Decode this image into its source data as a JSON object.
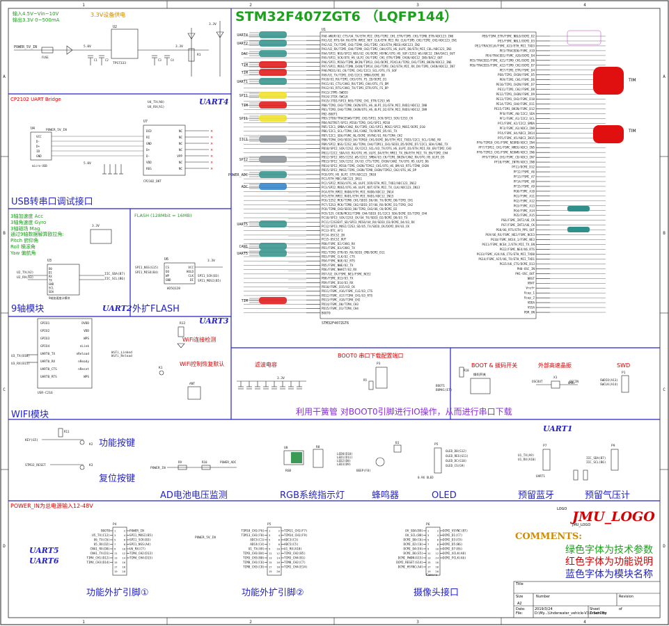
{
  "sheet": {
    "title": "STM32F407ZGT6 （LQFP144）",
    "mcu_ref": "U1",
    "mcu_part": "STM32F407ZGT6",
    "grid_top": [
      "1",
      "2",
      "3",
      "4",
      "5",
      "6"
    ],
    "grid_side": [
      "A",
      "B",
      "C",
      "D"
    ]
  },
  "modules": {
    "power_note": "输入4.5V~Vin~10V\n输出3.3V 0~500mA",
    "power_title": "3.3V设备供电",
    "usb_bridge": "CP2102 UART Bridge",
    "uart4": "UART4",
    "usb_title": "USB转串口调试接口",
    "imu_desc": "3轴加速度 Acc\n3轴角速度 Gyro\n3轴磁场 Mag\n通过9轴数据解算欧拉角:\nPitch 俯仰角\nRoll 横滚角\nYaw 偏航角",
    "imu_title": "9轴模块",
    "uart2": "UART2",
    "flash_note": "FLASH (128Mbit = 16MB)",
    "flash_title": "外扩FLASH",
    "uart3": "UART3",
    "wifi_detect": "WiFi连接检测",
    "wifi_ctrl": "WiFi控制恢复默认",
    "wifi_title": "WIFI模块",
    "filter_cap": "滤波电容",
    "boot0_title": "BOOT0 串口下载配置端口",
    "boot_switch": "BOOT & 拨码开关",
    "ext_osc": "外部高速晶振",
    "swd": "SWD",
    "boot0_desc": "利用干簧管 对BOOT0引脚进行IO操作，从而进行串口下载",
    "func_key": "功能按键",
    "reset_key": "复位按键",
    "ad_title": "AD电池电压监测",
    "rgb_title": "RGB系统指示灯",
    "buzzer_title": "蜂鸣器",
    "oled_title": "OLED",
    "uart1": "UART1",
    "bt_title": "预留蓝牙",
    "baro_title": "预留气压计",
    "power_in_note": "POWER_IN为总电源输入12-48V",
    "uart5": "UART5",
    "uart6": "UART6",
    "ext1_title": "功能外扩引脚①",
    "ext2_title": "功能外扩引脚②",
    "cam_title": "摄像头接口",
    "logo_text": "JMU_LOGO",
    "logo_small": "LOGO",
    "logo_sub": "JMU_LOGO",
    "comments": "COMMENTS:",
    "cmt_green": "绿色字体为技术参数",
    "cmt_red": "红色字体为功能说明",
    "cmt_blue": "蓝色字体为模块名称"
  },
  "title_block": {
    "title": "Title",
    "size_label": "Size",
    "size": "A2",
    "number_label": "Number",
    "revision_label": "Revision",
    "date_label": "Date:",
    "date": "2019/3/24",
    "sheet_label": "Sheet",
    "of": "of",
    "file_label": "File:",
    "file": "D:\\My...\\Underwater_vehicle-V3.0.SchDoc",
    "drawn_label": "Drawn By:"
  },
  "tags": {
    "tim_right": "TIM",
    "tim_right2": "TIM"
  },
  "colors": {
    "frame": "#2323c8",
    "wire": "#1a1a1a",
    "green_title": "#1ba11b",
    "blue_label": "#2323c8",
    "red_text": "#d40000",
    "orange": "#d08a00",
    "tag_red": "#e01010",
    "tag_yellow": "#f0e020",
    "tag_grey": "#8a8f96",
    "tag_teal": "#2f8f8a",
    "tag_blue": "#2a80c8",
    "tag_magenta": "#b000b0"
  },
  "mcu_pins_left": [
    "PA0-WKUP/U2_CTS/U4_TX/ETH_MII_CRS/TIM2_CH1_ETR/TIM5_CH1/TIM8_ETR/ADC123_IN0",
    "PA1/U2_RTS/U4_RX/ETH_RMII_REF_CLK/ETH_MII_RX_CLK/TIM5_CH2/TIM2_CH2/ADC123_IN1",
    "PA2/U2_TX/TIM5_CH3/TIM9_CH1/TIM2_CH3/ETH_MDIO/ADC123_IN2",
    "PA3/U2_RX/TIM5_CH4/TIM9_CH2/TIM2_CH4/OTG_HS_ULPI_D0/ETH_MII_COL/ADC123_IN3",
    "PA4/SPI1_NSS/SPI3_NSS/U2_CK/DCMI_HSYNC/OTG_HS_SOF/I2S3_WS/ADC12_IN4/DAC1_OUT",
    "PA5/SPI1_SCK/OTG_HS_ULPI_CK/TIM2_CH1_ETR/TIM8_CH1N/ADC12_IN5/DAC2_OUT",
    "PA6/SPI1_MISO/TIM8_BKIN/TIM13_CH1/DCMI_PIXCLK/TIM3_CH1/TIM1_BKIN/ADC12_IN6",
    "PA7/SPI1_MOSI/TIM8_CH1N/TIM14_CH1/TIM3_CH2/ETH_MII_RX_DV/TIM1_CH1N/ADC12_IN7",
    "PA8/MCO1/U1_CK/TIM1_CH1/I2C3_SCL/OTG_FS_SOF",
    "PA9/U1_TX/TIM1_CH2/I2C3_SMBA/DCMI_D0",
    "PA10/U1_RX/TIM1_CH3/OTG_FS_ID/DCMI_D1",
    "PA11/U1_CTS/CAN1_RX/TIM1_CH4/OTG_FS_DM",
    "PA12/U1_RTS/CAN1_TX/TIM1_ETR/OTG_FS_DP",
    "PA13/JTMS-SWDIO",
    "PA14/JTCK-SWCLK",
    "PA15/JTDI/SPI3_NSS/TIM2_CH1_ETR/I2S3_WS",
    "PB0/TIM3_CH3/TIM8_CH2N/OTG_HS_ULPI_D1/ETH_MII_RXD2/ADC12_IN8",
    "PB1/TIM3_CH4/TIM8_CH3N/OTG_HS_ULPI_D2/ETH_MII_RXD3/ADC12_IN9",
    "PB2-BOOT1",
    "PB3/JTDO/TRACESWO/TIM2_CH2/SPI1_SCK/SPI3_SCK/I2S3_CK",
    "PB4/NJTRST/SPI3_MISO/TIM3_CH1/SPI1_MISO",
    "PB5/I2C1_SMBA/CAN2_RX/TIM3_CH2/SPI1_MOSI/SPI3_MOSI/DCMI_D10",
    "PB6/I2C1_SCL/TIM4_CH1/CAN2_TX/DCMI_D5/U1_TX",
    "PB7/I2C1_SDA/FSMC_NL/DCMI_VSYNC/U1_RX/TIM4_CH2",
    "PB8/TIM4_CH3/SDIO_D4/TIM10_CH1/DCMI_D6/ETH_MII_TXD3/I2C1_SCL/CAN1_RX",
    "PB9/SPI2_NSS/I2S2_WS/TIM4_CH4/TIM11_CH1/SDIO_D5/DCMI_D7/I2C1_SDA/CAN1_TX",
    "PB10/SPI2_SCK/I2S2_CK/I2C2_SCL/U3_TX/OTG_HS_ULPI_D3/ETH_MII_RX_ER/TIM2_CH3",
    "PB11/I2C2_SDA/U3_RX/OTG_HS_ULPI_D4/ETH_RMII_TX_EN/ETH_MII_TX_EN/TIM2_CH4",
    "PB12/SPI2_NSS/I2S2_WS/I2C2_SMBA/U3_CK/TIM1_BKIN/CAN2_RX/OTG_HS_ULPI_D5",
    "PB13/SPI2_SCK/I2S2_CK/U3_CTS/TIM1_CH1N/CAN2_TX/OTG_HS_ULPI_D6",
    "PB14/SPI2_MISO/TIM1_CH2N/TIM12_CH1/OTG_HS_DM/U3_RTS/TIM8_CH2N",
    "PB15/SPI2_MOSI/TIM1_CH3N/TIM8_CH3N/TIM12_CH2/OTG_HS_DP",
    "PC0/OTG_HS_ULPI_STP/ADC123_IN10",
    "PC1/ETH_MDC/ADC123_IN11",
    "PC2/SPI2_MISO/OTG_HS_ULPI_DIR/ETH_MII_TXD2/ADC123_IN12",
    "PC3/SPI2_MOSI/OTG_HS_ULPI_NXT/ETH_MII_TX_CLK/ADC123_IN13",
    "PC4/ETH_RMII_RXD0/ETH_MII_RXD0/ADC12_IN14",
    "PC5/ETH_RMII_RXD1/ETH_MII_RXD1/ADC12_IN15",
    "PC6/I2S2_MCK/TIM8_CH1/SDIO_D6/U6_TX/DCMI_D0/TIM3_CH1",
    "PC7/I2S3_MCK/TIM8_CH2/SDIO_D7/U6_RX/DCMI_D1/TIM3_CH2",
    "PC8/TIM8_CH3/SDIO_D0/TIM3_CH3/U6_CK/DCMI_D2",
    "PC9/I2S_CKIN/MCO2/TIM8_CH4/SDIO_D1/I2C3_SDA/DCMI_D3/TIM3_CH4",
    "PC10/SPI3_SCK/I2S3_CK/U4_TX/SDIO_D2/DCMI_D8/U3_TX",
    "PC11/I2S3EXT_SD/SPI3_MISO/U4_RX/SDIO_D3/DCMI_D4/U3_RX",
    "PC12/SPI3_MOSI/I2S3_SD/U5_TX/SDIO_CK/DCMI_D9/U3_CK",
    "PC13-RTC_AF1",
    "PC14-OSC32_IN",
    "PC15-OSC32_OUT",
    "PD0/FSMC_D2/CAN1_RX",
    "PD1/FSMC_D3/CAN1_TX",
    "PD2/TIM3_ETR/U5_RX/SDIO_CMD/DCMI_D11",
    "PD3/FSMC_CLK/U2_CTS",
    "PD4/FSMC_NOE/U2_RTS",
    "PD5/FSMC_NWE/U2_TX",
    "PD6/FSMC_NWAIT/U2_RX",
    "PD7/U2_CK/FSMC_NE1/FSMC_NCE2",
    "PD8/FSMC_D13/U3_TX",
    "PD9/FSMC_D14/U3_RX",
    "PD10/FSMC_D15/U3_CK",
    "PD11/FSMC_A16/FSMC_CLE/U3_CTS",
    "PD12/FSMC_A17/TIM4_CH1/U3_RTS",
    "PD13/FSMC_A18/TIM4_CH2",
    "PD14/FSMC_D0/TIM4_CH3",
    "PD15/FSMC_D1/TIM4_CH4",
    "BOOT0"
  ],
  "mcu_pins_right": [
    "PE0/TIM4_ETR/FSMC_NBL0/DCMI_D2",
    "PE1/FSMC_NBL1/DCMI_D3",
    "PE2/TRACECLK/FSMC_A23/ETH_MII_TXD3",
    "PE3/TRACED0/FSMC_A19",
    "PE4/TRACED1/FSMC_A20/DCMI_D4",
    "PE5/TRACED2/FSMC_A21/TIM9_CH1/DCMI_D6",
    "PE6/TRACED3/FSMC_A22/TIM9_CH2/DCMI_D7",
    "PE7/TIM1_ETR/FSMC_D4",
    "PE8/TIM1_CH1N/FSMC_D5",
    "PE9/TIM1_CH1/FSMC_D6",
    "PE10/TIM1_CH2N/FSMC_D7",
    "PE11/TIM1_CH2/FSMC_D8",
    "PE12/TIM1_CH3N/FSMC_D9",
    "PE13/TIM1_CH3/FSMC_D10",
    "PE14/TIM1_CH4/FSMC_D11",
    "PE15/TIM1_BKIN/FSMC_D12",
    "PF0/FSMC_A0/I2C2_SDA",
    "PF1/FSMC_A1/I2C2_SCL",
    "PF2/FSMC_A2/I2C2_SMBA",
    "PF3/FSMC_A3/ADC3_IN9",
    "PF4/FSMC_A4/ADC3_IN14",
    "PF5/FSMC_A5/ADC3_IN15",
    "PF6/TIM10_CH1/FSMC_NIORD/ADC3_IN4",
    "PF7/TIM11_CH1/FSMC_NREG/ADC3_IN5",
    "PF8/TIM13_CH1/FSMC_NIOWR/ADC3_IN6",
    "PF9/TIM14_CH1/FSMC_CD/ADC3_IN7",
    "PF10/FSMC_INTR/ADC3_IN8",
    "PF11/DCMI_D12",
    "PF12/FSMC_A6",
    "PF13/FSMC_A7",
    "PF14/FSMC_A8",
    "PF15/FSMC_A9",
    "PG0/FSMC_A10",
    "PG1/FSMC_A11",
    "PG2/FSMC_A12",
    "PG3/FSMC_A13",
    "PG4/FSMC_A14",
    "PG5/FSMC_A15",
    "PG6/FSMC_INT2/U6_CK",
    "PG7/FSMC_INT3/U6_CK",
    "PG8/U6_RTS/ETH_PPS_OUT",
    "PG9/U6_RX/FSMC_NE2/FSMC_NCE3",
    "PG10/FSMC_NCE4_1/FSMC_NE3",
    "PG11/FSMC_NCE4_2/ETH_MII_TX_EN",
    "PG12/FSMC_NE4/U6_RTS",
    "PG13/FSMC_A24/U6_CTS/ETH_MII_TXD0",
    "PG14/FSMC_A25/U6_TX/ETH_MII_TXD1",
    "PG15/U6_CTS/DCMI_D13",
    "PH0-OSC_IN",
    "PH1-OSC_OUT",
    "NRST",
    "VBAT",
    "Vref+",
    "Vcap_1",
    "Vcap_2",
    "VDDA",
    "VSSA",
    "PDR_ON"
  ],
  "tags_left": [
    {
      "label": "UART4",
      "color": "#2f8f8a"
    },
    {
      "label": "UART2",
      "color": "#2f8f8a"
    },
    {
      "label": "DAC",
      "color": "#2f8f8a"
    },
    {
      "label": "TIM",
      "color": "#e01010"
    },
    {
      "label": "TIM",
      "color": "#e01010"
    },
    {
      "label": "UART1",
      "color": "#2f8f8a"
    },
    {
      "label": "SPI1",
      "color": "#f0e020"
    },
    {
      "label": "TIM",
      "color": "#e01010"
    },
    {
      "label": "SPI1",
      "color": "#f0e020"
    },
    {
      "label": "IIC1",
      "color": "#8a8f96"
    },
    {
      "label": "SPI2",
      "color": "#8a8f96"
    },
    {
      "label": "POWER_ADC",
      "color": "#2f8f8a"
    },
    {
      "label": "ADC",
      "color": "#2a80c8"
    },
    {
      "label": "UART5",
      "color": "#2f8f8a"
    },
    {
      "label": "CAN1",
      "color": "#2f8f8a"
    },
    {
      "label": "UART5",
      "color": "#2f8f8a"
    },
    {
      "label": "TIM",
      "color": "#e01010"
    }
  ],
  "ext_header_1": {
    "ref": "P4",
    "left": [
      "BOOT0",
      "U5_TX(C12)",
      "U6_TX(C6)",
      "U5_RX(D2)",
      "CNA1_RX(D0)",
      "CNA1_TX(D1)",
      "TIM4_CH1(D12)",
      "TIM4_CH3(D14)"
    ],
    "right": [
      "POWER_IN",
      "SPI1_MOSI(B5)",
      "SPI1_SCK(B3)",
      "SPI1_NSS(A4)",
      "U6_RX(C7)",
      "TIM4_CH2(D13)",
      "TIM4_CH4(D15)"
    ],
    "power_net": "POWER_5V_IN"
  },
  "ext_header_2": {
    "ref": "P5",
    "left": [
      "TIM10_CH1(F6)",
      "TIM13_CH1(F8)",
      "ADC3(C1)",
      "ADC4(C4)",
      "U1_TX(A9)",
      "TIM3_CH1(B4)",
      "TIM3_CH3(B0)",
      "TIM8_CH1(C6)",
      "TIM8_CH3(C8)"
    ],
    "right": [
      "TIM11_CH1(F7)",
      "TIM14_CH1(F9)",
      "ADC3(C3)",
      "ADC5(C5)",
      "U1_RX(A10)",
      "TIM3_CH2(B5)",
      "TIM3_CH4(B1)",
      "TIM8_CH2(C7)",
      "TIM1_CH4(E14)"
    ]
  },
  "cam_header": {
    "ref": "P6",
    "name": "Camera",
    "left": [
      "OV_SDA(B9)",
      "OV_SCL(B8)",
      "DCMI_D0(C6)",
      "DCMI_D2(C8)",
      "DCMI_D4(E4)",
      "DCMI_D6(E5)",
      "DCMI_PWDN(G15)",
      "DCMI_RESET(G14)",
      "DCMI_HSYNC(A4)"
    ],
    "right": [
      "DCMI_VSYNC(B7)",
      "DCMI_D1(C7)",
      "DCMI_D3(C9)",
      "DCMI_D5(B6)",
      "DCMI_D7(E6)",
      "DCMI_XCLK(A8)",
      "DCMI_PCLK(A6)"
    ]
  }
}
